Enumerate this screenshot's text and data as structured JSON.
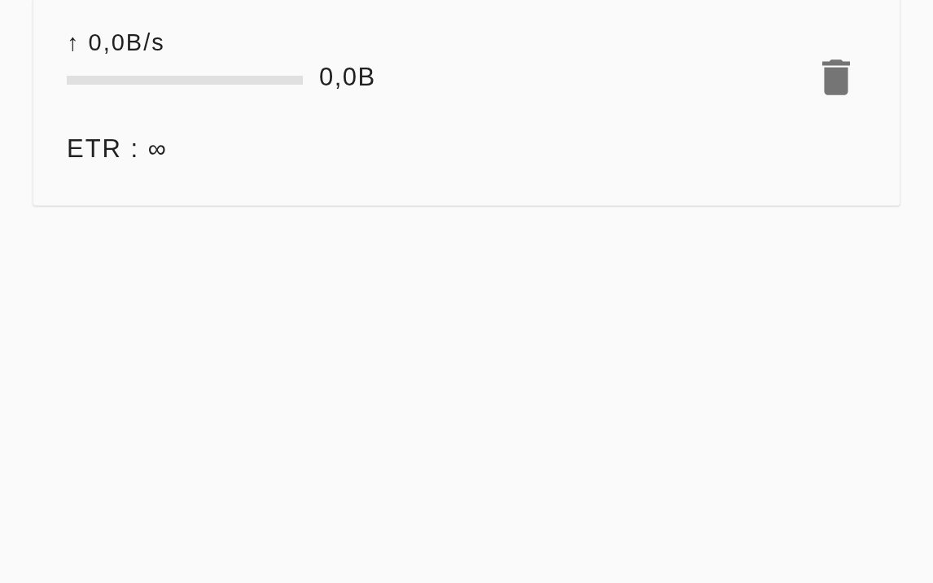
{
  "torrent": {
    "upload_speed": "↑ 0,0B/s",
    "progress": {
      "level": 0
    },
    "size": "0,0B",
    "etr": "ETR : ∞"
  }
}
